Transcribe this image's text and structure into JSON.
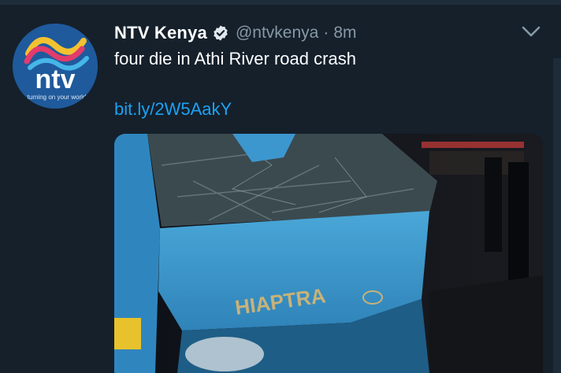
{
  "tweet": {
    "display_name": "NTV Kenya",
    "handle": "@ntvkenya",
    "separator": "·",
    "time": "8m",
    "text": "four die in Athi River road crash",
    "link": "bit.ly/2W5AakY"
  },
  "avatar": {
    "logo_text": "ntv",
    "tagline": "turning on your world"
  },
  "media": {
    "plate_text": "HIAPTRA"
  },
  "icons": {
    "verified": "verified-badge-icon",
    "more": "chevron-down-icon"
  },
  "colors": {
    "background": "#15202b",
    "link": "#1da1f2",
    "secondary_text": "#8899a6",
    "van_blue": "#3a9bd0"
  }
}
